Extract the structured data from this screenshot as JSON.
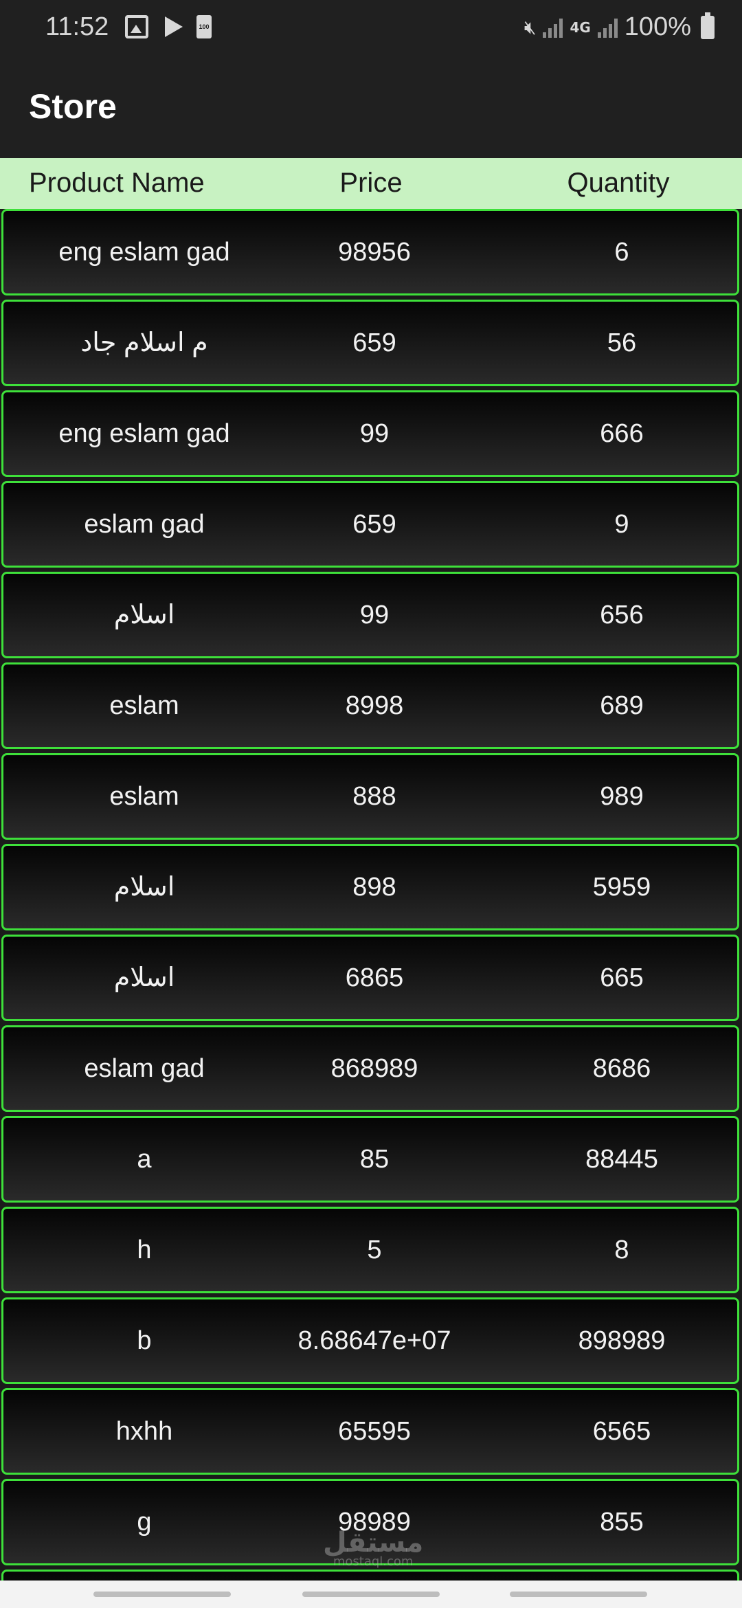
{
  "status_bar": {
    "time": "11:52",
    "battery_small_label": "100",
    "network_type": "4G",
    "battery_percent": "100%"
  },
  "app_bar": {
    "title": "Store"
  },
  "table": {
    "headers": {
      "name": "Product Name",
      "price": "Price",
      "quantity": "Quantity"
    },
    "rows": [
      {
        "name": "eng eslam gad",
        "price": "98956",
        "quantity": "6"
      },
      {
        "name": "م اسلام جاد",
        "price": "659",
        "quantity": "56"
      },
      {
        "name": "eng eslam gad",
        "price": "99",
        "quantity": "666"
      },
      {
        "name": "eslam gad",
        "price": "659",
        "quantity": "9"
      },
      {
        "name": "اسلام",
        "price": "99",
        "quantity": "656"
      },
      {
        "name": "eslam",
        "price": "8998",
        "quantity": "689"
      },
      {
        "name": "eslam",
        "price": "888",
        "quantity": "989"
      },
      {
        "name": "اسلام",
        "price": "898",
        "quantity": "5959"
      },
      {
        "name": "اسلام",
        "price": "6865",
        "quantity": "665"
      },
      {
        "name": "eslam gad",
        "price": "868989",
        "quantity": "8686"
      },
      {
        "name": "a",
        "price": "85",
        "quantity": "88445"
      },
      {
        "name": "h",
        "price": "5",
        "quantity": "8"
      },
      {
        "name": "b",
        "price": "8.68647e+07",
        "quantity": "898989"
      },
      {
        "name": "hxhh",
        "price": "65595",
        "quantity": "6565"
      },
      {
        "name": "g",
        "price": "98989",
        "quantity": "855"
      }
    ]
  },
  "watermark": {
    "arabic": "مستقل",
    "latin": "mostaql.com"
  },
  "icons": {
    "status_left": [
      "gallery-icon",
      "play-store-icon",
      "battery-saver-icon"
    ],
    "status_right": [
      "mute-icon",
      "signal-icon",
      "network-4g-icon",
      "signal-icon",
      "battery-icon"
    ]
  }
}
